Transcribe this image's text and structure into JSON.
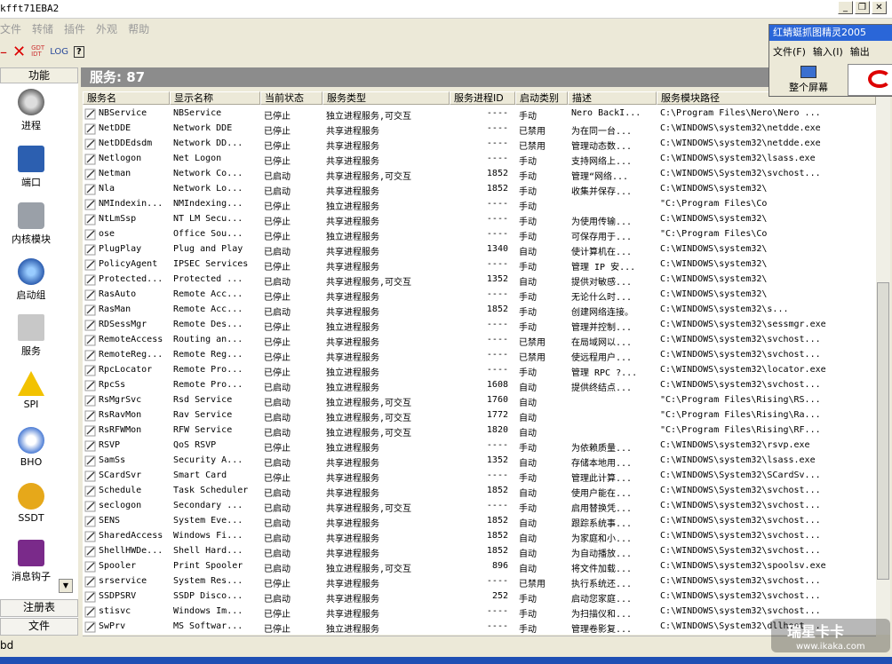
{
  "window": {
    "title": "kfft71EBA2"
  },
  "menubar": [
    "文件",
    "转储",
    "插件",
    "外观",
    "帮助"
  ],
  "toolbar": {
    "log": "LOG",
    "help": "?"
  },
  "sidebar": {
    "header": "功能",
    "items": [
      "进程",
      "端口",
      "内核模块",
      "启动组",
      "服务",
      "SPI",
      "BHO",
      "SSDT",
      "消息钩子"
    ],
    "footer": [
      "注册表",
      "文件"
    ]
  },
  "service_count": "服务: 87",
  "table": {
    "columns": [
      "服务名",
      "显示名称",
      "当前状态",
      "服务类型",
      "服务进程ID",
      "启动类别",
      "描述",
      "服务模块路径"
    ],
    "rows": [
      [
        "NBService",
        "NBService",
        "已停止",
        "独立进程服务,可交互",
        "----",
        "手动",
        "Nero BackI...",
        "C:\\Program Files\\Nero\\Nero ..."
      ],
      [
        "NetDDE",
        "Network DDE",
        "已停止",
        "共享进程服务",
        "----",
        "已禁用",
        "为在同一台...",
        "C:\\WINDOWS\\system32\\netdde.exe"
      ],
      [
        "NetDDEdsdm",
        "Network DD...",
        "已停止",
        "共享进程服务",
        "----",
        "已禁用",
        "管理动态数...",
        "C:\\WINDOWS\\system32\\netdde.exe"
      ],
      [
        "Netlogon",
        "Net Logon",
        "已停止",
        "共享进程服务",
        "----",
        "手动",
        "支持网络上...",
        "C:\\WINDOWS\\system32\\lsass.exe"
      ],
      [
        "Netman",
        "Network Co...",
        "已启动",
        "共享进程服务,可交互",
        "1852",
        "手动",
        "管理“网络...",
        "C:\\WINDOWS\\System32\\svchost..."
      ],
      [
        "Nla",
        "Network Lo...",
        "已启动",
        "共享进程服务",
        "1852",
        "手动",
        "收集并保存...",
        "C:\\WINDOWS\\system32\\"
      ],
      [
        "NMIndexin...",
        "NMIndexing...",
        "已停止",
        "独立进程服务",
        "----",
        "手动",
        "",
        "\"C:\\Program Files\\Co"
      ],
      [
        "NtLmSsp",
        "NT LM Secu...",
        "已停止",
        "共享进程服务",
        "----",
        "手动",
        "为使用传输...",
        "C:\\WINDOWS\\system32\\"
      ],
      [
        "ose",
        "Office Sou...",
        "已停止",
        "独立进程服务",
        "----",
        "手动",
        "可保存用于...",
        "\"C:\\Program Files\\Co"
      ],
      [
        "PlugPlay",
        "Plug and Play",
        "已启动",
        "共享进程服务",
        "1340",
        "自动",
        "使计算机在...",
        "C:\\WINDOWS\\system32\\"
      ],
      [
        "PolicyAgent",
        "IPSEC Services",
        "已停止",
        "共享进程服务",
        "----",
        "手动",
        "管理 IP 安...",
        "C:\\WINDOWS\\system32\\"
      ],
      [
        "Protected...",
        "Protected ...",
        "已启动",
        "共享进程服务,可交互",
        "1352",
        "自动",
        "提供对敏感...",
        "C:\\WINDOWS\\system32\\"
      ],
      [
        "RasAuto",
        "Remote Acc...",
        "已停止",
        "共享进程服务",
        "----",
        "手动",
        "无论什么时...",
        "C:\\WINDOWS\\system32\\"
      ],
      [
        "RasMan",
        "Remote Acc...",
        "已启动",
        "共享进程服务",
        "1852",
        "手动",
        "创建网络连接。",
        "C:\\WINDOWS\\system32\\s..."
      ],
      [
        "RDSessMgr",
        "Remote Des...",
        "已停止",
        "独立进程服务",
        "----",
        "手动",
        "管理并控制...",
        "C:\\WINDOWS\\system32\\sessmgr.exe"
      ],
      [
        "RemoteAccess",
        "Routing an...",
        "已停止",
        "共享进程服务",
        "----",
        "已禁用",
        "在局域网以...",
        "C:\\WINDOWS\\system32\\svchost..."
      ],
      [
        "RemoteReg...",
        "Remote Reg...",
        "已停止",
        "共享进程服务",
        "----",
        "已禁用",
        "使远程用户...",
        "C:\\WINDOWS\\system32\\svchost..."
      ],
      [
        "RpcLocator",
        "Remote Pro...",
        "已停止",
        "独立进程服务",
        "----",
        "手动",
        "管理 RPC ?...",
        "C:\\WINDOWS\\system32\\locator.exe"
      ],
      [
        "RpcSs",
        "Remote Pro...",
        "已启动",
        "独立进程服务",
        "1608",
        "自动",
        "提供终结点...",
        "C:\\WINDOWS\\system32\\svchost..."
      ],
      [
        "RsMgrSvc",
        "Rsd Service",
        "已启动",
        "独立进程服务,可交互",
        "1760",
        "自动",
        "",
        "\"C:\\Program Files\\Rising\\RS..."
      ],
      [
        "RsRavMon",
        "Rav Service",
        "已启动",
        "独立进程服务,可交互",
        "1772",
        "自动",
        "",
        "\"C:\\Program Files\\Rising\\Ra..."
      ],
      [
        "RsRFWMon",
        "RFW Service",
        "已启动",
        "独立进程服务,可交互",
        "1820",
        "自动",
        "",
        "\"C:\\Program Files\\Rising\\RF..."
      ],
      [
        "RSVP",
        "QoS RSVP",
        "已停止",
        "独立进程服务",
        "----",
        "手动",
        "为依赖质量...",
        "C:\\WINDOWS\\system32\\rsvp.exe"
      ],
      [
        "SamSs",
        "Security A...",
        "已启动",
        "共享进程服务",
        "1352",
        "自动",
        "存储本地用...",
        "C:\\WINDOWS\\system32\\lsass.exe"
      ],
      [
        "SCardSvr",
        "Smart Card",
        "已停止",
        "共享进程服务",
        "----",
        "手动",
        "管理此计算...",
        "C:\\WINDOWS\\System32\\SCardSv..."
      ],
      [
        "Schedule",
        "Task Scheduler",
        "已启动",
        "共享进程服务",
        "1852",
        "自动",
        "使用户能在...",
        "C:\\WINDOWS\\System32\\svchost..."
      ],
      [
        "seclogon",
        "Secondary ...",
        "已启动",
        "共享进程服务,可交互",
        "----",
        "手动",
        "启用替换凭...",
        "C:\\WINDOWS\\system32\\svchost..."
      ],
      [
        "SENS",
        "System Eve...",
        "已启动",
        "共享进程服务",
        "1852",
        "自动",
        "跟踪系统事...",
        "C:\\WINDOWS\\system32\\svchost..."
      ],
      [
        "SharedAccess",
        "Windows Fi...",
        "已启动",
        "共享进程服务",
        "1852",
        "自动",
        "为家庭和小...",
        "C:\\WINDOWS\\system32\\svchost..."
      ],
      [
        "ShellHWDe...",
        "Shell Hard...",
        "已启动",
        "共享进程服务",
        "1852",
        "自动",
        "为自动播放...",
        "C:\\WINDOWS\\System32\\svchost..."
      ],
      [
        "Spooler",
        "Print Spooler",
        "已启动",
        "独立进程服务,可交互",
        "896",
        "自动",
        "将文件加载...",
        "C:\\WINDOWS\\system32\\spoolsv.exe"
      ],
      [
        "srservice",
        "System Res...",
        "已停止",
        "共享进程服务",
        "----",
        "已禁用",
        "执行系统还...",
        "C:\\WINDOWS\\system32\\svchost..."
      ],
      [
        "SSDPSRV",
        "SSDP Disco...",
        "已启动",
        "共享进程服务",
        "252",
        "手动",
        "启动您家庭...",
        "C:\\WINDOWS\\system32\\svchost..."
      ],
      [
        "stisvc",
        "Windows Im...",
        "已停止",
        "共享进程服务",
        "----",
        "手动",
        "为扫描仪和...",
        "C:\\WINDOWS\\system32\\svchost..."
      ],
      [
        "SwPrv",
        "MS Softwar...",
        "已停止",
        "独立进程服务",
        "----",
        "手动",
        "管理卷影复...",
        "C:\\WINDOWS\\System32\\dllhost..."
      ]
    ]
  },
  "float_window": {
    "title": "红蜻蜓抓图精灵2005",
    "menu": [
      "文件(F)",
      "输入(I)",
      "输出"
    ],
    "button": "整个屏幕"
  },
  "statusbar": {
    "left": "bd"
  },
  "watermark": {
    "brand": "瑞星卡卡",
    "url": "www.ikaka.com"
  }
}
